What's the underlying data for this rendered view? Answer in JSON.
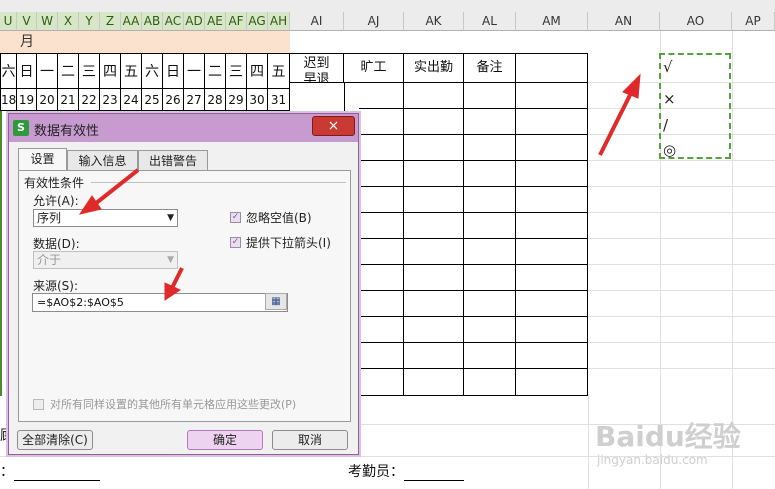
{
  "spreadsheet": {
    "column_headers_left": [
      "U",
      "V",
      "W",
      "X",
      "Y",
      "Z",
      "AA",
      "AB",
      "AC",
      "AD",
      "AE",
      "AF",
      "AG",
      "AH"
    ],
    "column_headers_right": [
      "AI",
      "AJ",
      "AK",
      "AL",
      "AM",
      "AN",
      "AO",
      "AP"
    ],
    "month_label": "月",
    "weekday_row": [
      "六",
      "日",
      "一",
      "二",
      "三",
      "四",
      "五",
      "六",
      "日",
      "一",
      "二",
      "三",
      "四",
      "五"
    ],
    "day_row": [
      "18",
      "19",
      "20",
      "21",
      "22",
      "23",
      "24",
      "25",
      "26",
      "27",
      "28",
      "29",
      "30",
      "31"
    ],
    "summary_headers": [
      "迟到\n早退",
      "旷工",
      "实出勤",
      "备注"
    ],
    "ao_marks": [
      "√",
      "×",
      "/",
      "◎"
    ],
    "bottom_label_left": "：",
    "bottom_label_checker": "考勤员：",
    "partial_left_char": "顾"
  },
  "dialog": {
    "title": "数据有效性",
    "close_label": "×",
    "tabs": [
      "设置",
      "输入信息",
      "出错警告"
    ],
    "active_tab": "设置",
    "group_title": "有效性条件",
    "allow_label": "允许(A):",
    "allow_value": "序列",
    "data_label": "数据(D):",
    "data_value": "介于",
    "ignore_blank_label": "忽略空值(B)",
    "ignore_blank_checked": true,
    "dropdown_label": "提供下拉箭头(I)",
    "dropdown_checked": true,
    "source_label": "来源(S):",
    "source_value": "=$AO$2:$AO$5",
    "apply_all_label": "对所有同样设置的其他所有单元格应用这些更改(P)",
    "apply_all_checked": false,
    "clear_all_label": "全部清除(C)",
    "ok_label": "确定",
    "cancel_label": "取消"
  },
  "watermark": {
    "brand": "Baidu经验",
    "url": "jingyan.baidu.com"
  },
  "colors": {
    "arrow_red": "#e02a2a",
    "dialog_title": "#c79bd0",
    "selection_green": "#55a03a"
  }
}
